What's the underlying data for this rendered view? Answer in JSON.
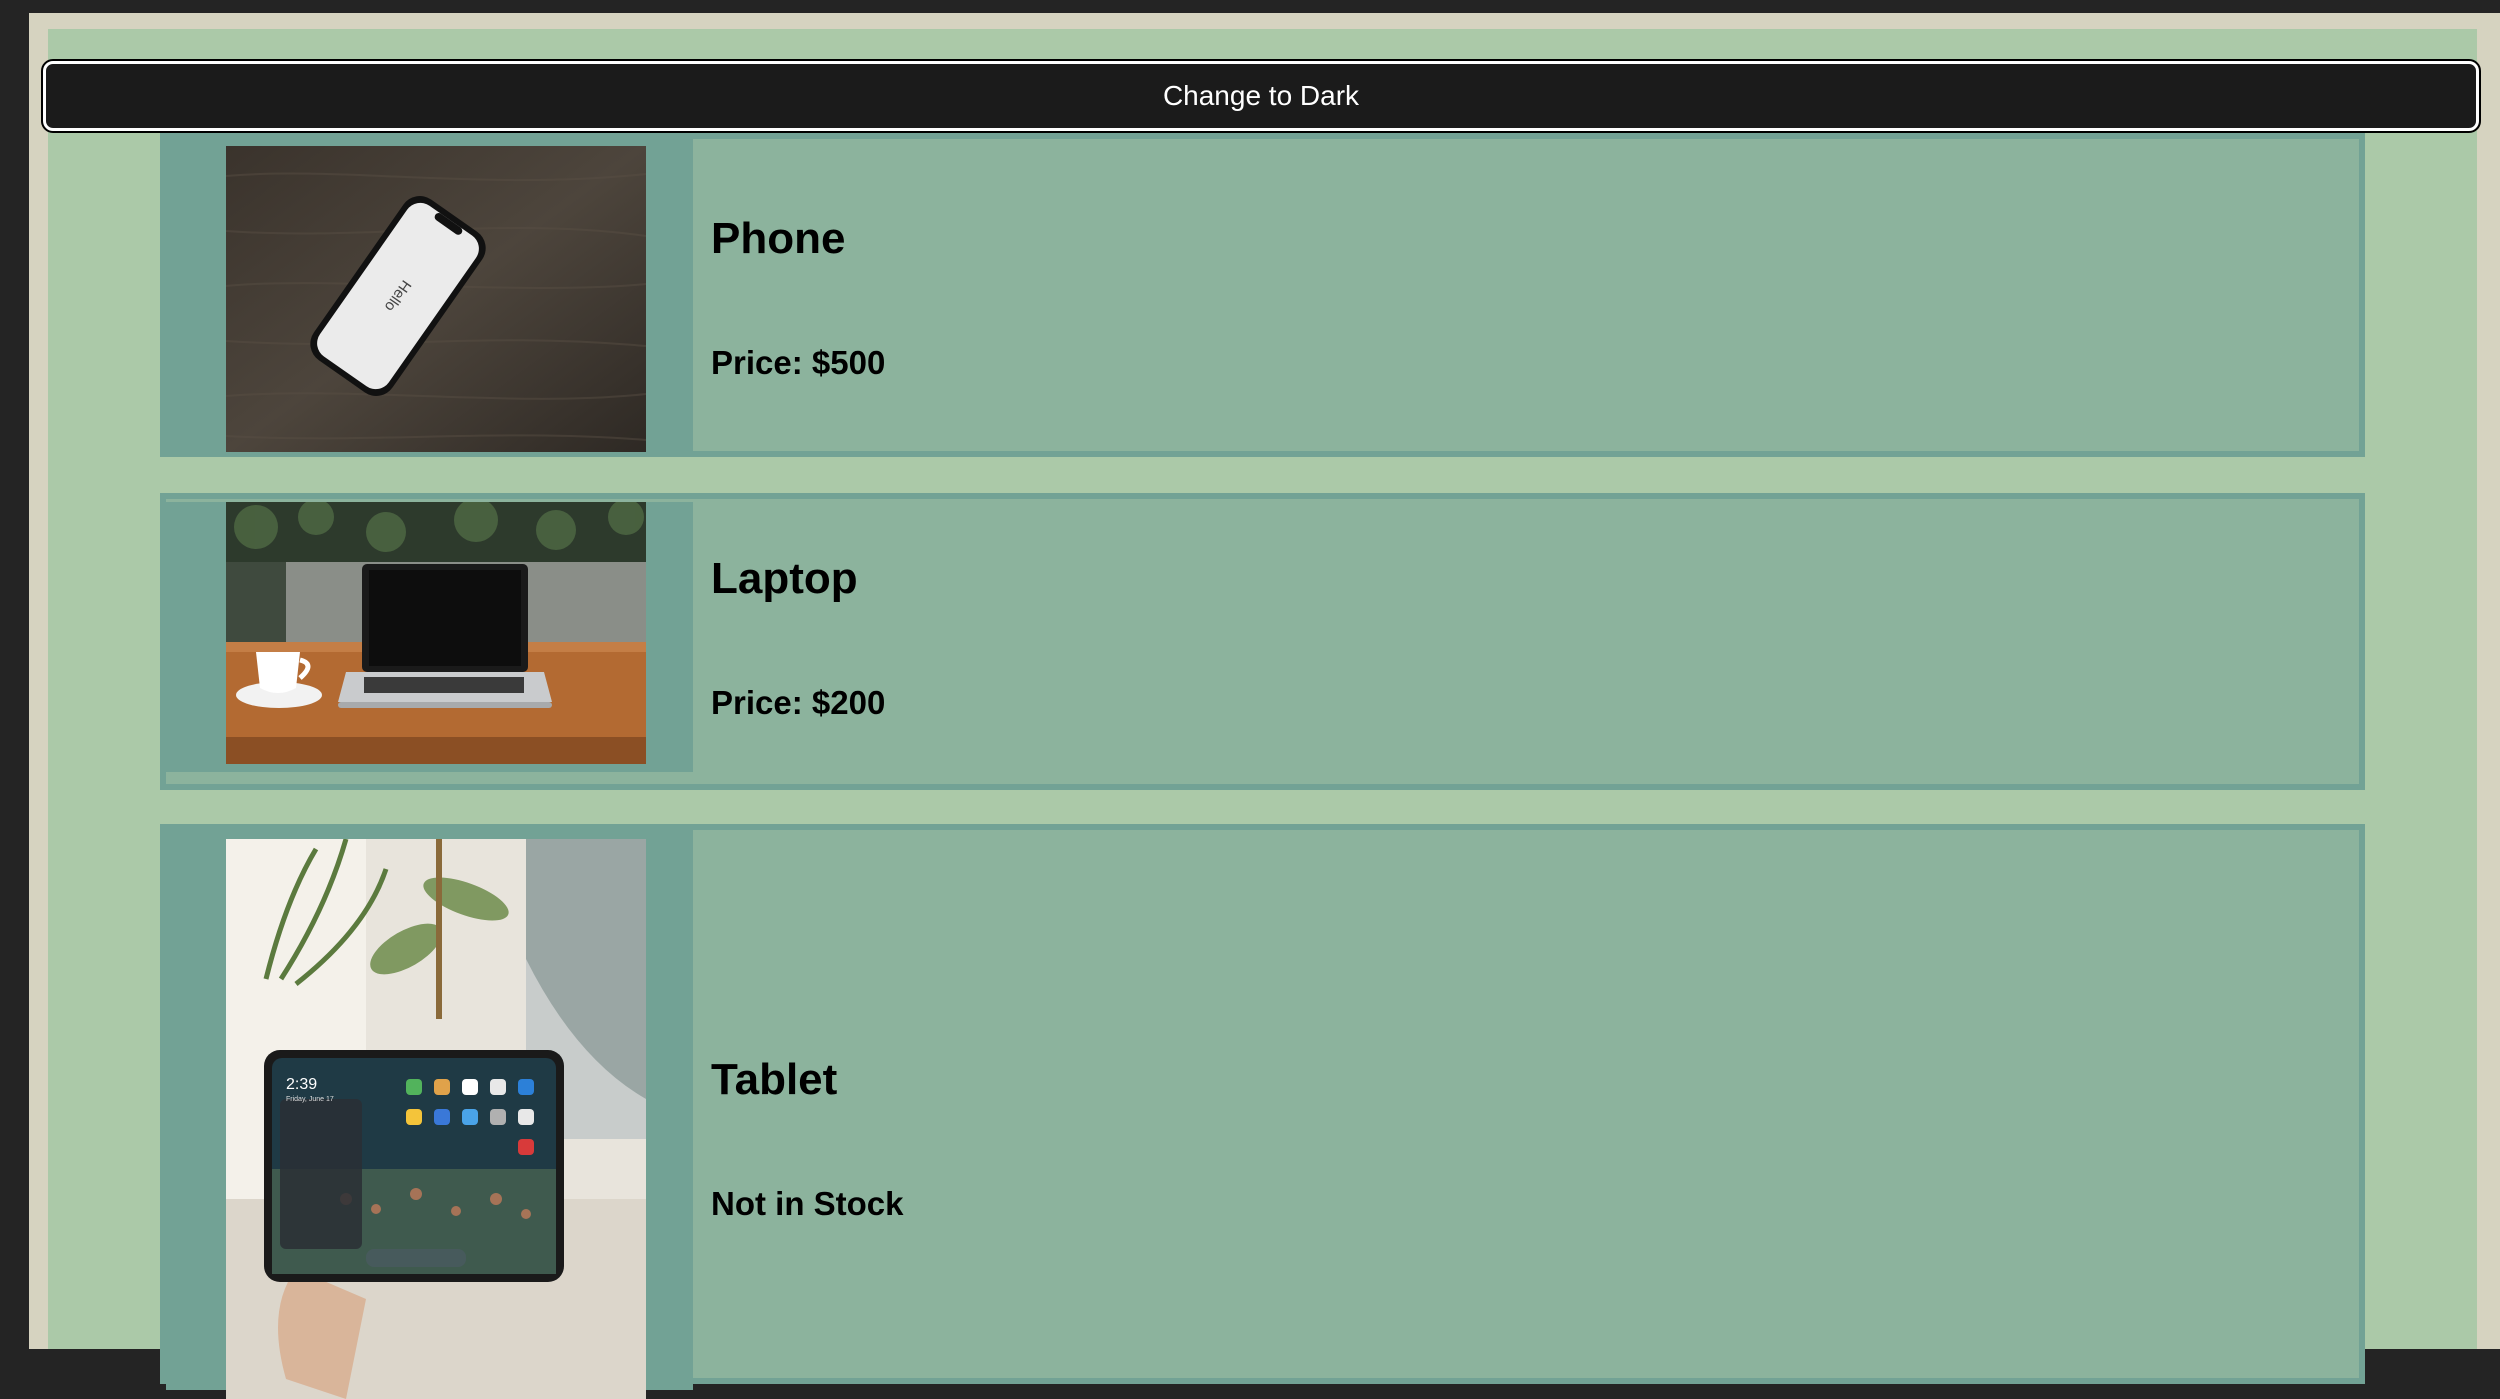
{
  "theme_toggle": {
    "label": "Change to Dark"
  },
  "products": [
    {
      "name": "Phone",
      "price_text": "Price: $500",
      "image_icon": "phone-photo",
      "screen_text": "Hello"
    },
    {
      "name": "Laptop",
      "price_text": "Price: $200",
      "image_icon": "laptop-photo"
    },
    {
      "name": "Tablet",
      "price_text": "Not in Stock",
      "image_icon": "tablet-photo",
      "screen_time": "2:39",
      "screen_date": "Friday, June 17"
    }
  ],
  "colors": {
    "page_background": "#abc9a8",
    "card_background": "#8cb39d",
    "card_border": "#72a295",
    "button_background": "#1b1b1b",
    "button_text": "#ffffff"
  }
}
